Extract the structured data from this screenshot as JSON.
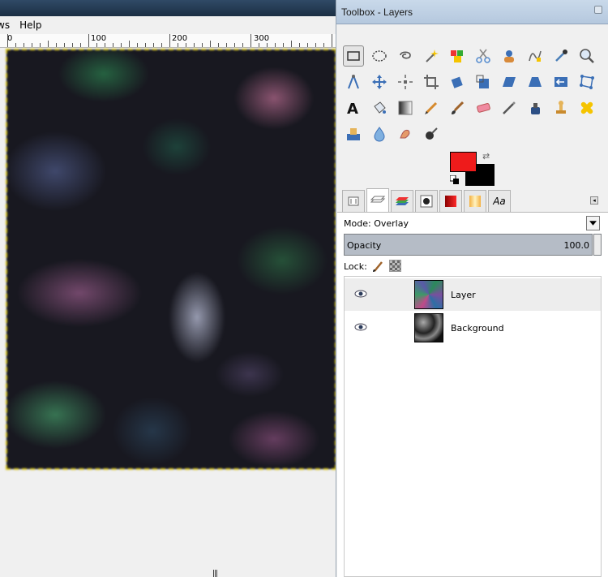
{
  "image_window": {
    "menu": [
      "ws",
      "Help"
    ],
    "ruler_labels": [
      "0",
      "100",
      "200",
      "300"
    ],
    "grip": "|||"
  },
  "dock": {
    "title": "Toolbox - Layers",
    "tools": [
      {
        "name": "rect-select",
        "icon": "rect-select-icon",
        "active": true
      },
      {
        "name": "ellipse-select",
        "icon": "ellipse-select-icon"
      },
      {
        "name": "free-select",
        "icon": "lasso-icon"
      },
      {
        "name": "fuzzy-select",
        "icon": "magic-wand-icon"
      },
      {
        "name": "select-by-color",
        "icon": "color-select-icon"
      },
      {
        "name": "scissors-select",
        "icon": "scissors-icon"
      },
      {
        "name": "foreground-select",
        "icon": "foreground-select-icon"
      },
      {
        "name": "paths",
        "icon": "paths-icon"
      },
      {
        "name": "color-picker",
        "icon": "eyedropper-icon"
      },
      {
        "name": "zoom",
        "icon": "magnifier-icon"
      },
      {
        "name": "measure",
        "icon": "compass-icon"
      },
      {
        "name": "move",
        "icon": "move-icon"
      },
      {
        "name": "align",
        "icon": "align-icon"
      },
      {
        "name": "crop",
        "icon": "crop-icon"
      },
      {
        "name": "rotate",
        "icon": "rotate-icon"
      },
      {
        "name": "scale",
        "icon": "scale-icon"
      },
      {
        "name": "shear",
        "icon": "shear-icon"
      },
      {
        "name": "perspective",
        "icon": "perspective-icon"
      },
      {
        "name": "flip",
        "icon": "flip-icon"
      },
      {
        "name": "cage-transform",
        "icon": "cage-icon"
      },
      {
        "name": "text",
        "icon": "text-icon"
      },
      {
        "name": "bucket-fill",
        "icon": "bucket-icon"
      },
      {
        "name": "blend",
        "icon": "gradient-icon"
      },
      {
        "name": "pencil",
        "icon": "pencil-icon"
      },
      {
        "name": "paintbrush",
        "icon": "brush-icon"
      },
      {
        "name": "eraser",
        "icon": "eraser-icon"
      },
      {
        "name": "airbrush",
        "icon": "airbrush-icon"
      },
      {
        "name": "ink",
        "icon": "ink-icon"
      },
      {
        "name": "clone",
        "icon": "clone-stamp-icon"
      },
      {
        "name": "heal",
        "icon": "heal-icon"
      },
      {
        "name": "perspective-clone",
        "icon": "perspective-clone-icon"
      },
      {
        "name": "blur-sharpen",
        "icon": "blur-icon"
      },
      {
        "name": "smudge",
        "icon": "smudge-icon"
      },
      {
        "name": "dodge-burn",
        "icon": "dodge-burn-icon"
      }
    ],
    "colors": {
      "foreground": "#ee1b1b",
      "background": "#000000"
    },
    "tab_font_label": "Aa",
    "layers": {
      "mode_label": "Mode:",
      "mode_value": "Overlay",
      "opacity_label": "Opacity",
      "opacity_value": "100.0",
      "lock_label": "Lock:",
      "items": [
        {
          "name": "Layer",
          "visible": true,
          "selected": true
        },
        {
          "name": "Background",
          "visible": true,
          "selected": false
        }
      ]
    }
  }
}
